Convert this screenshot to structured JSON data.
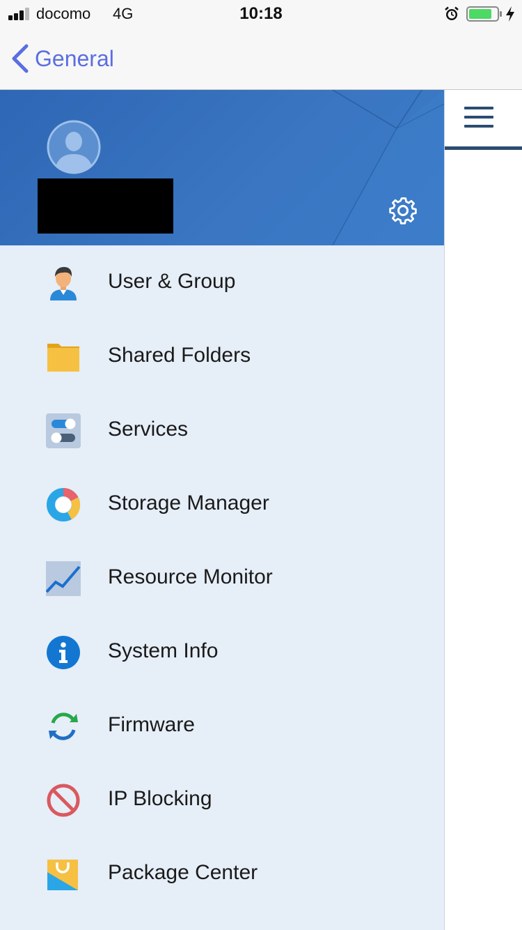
{
  "status_bar": {
    "carrier": "docomo",
    "network": "4G",
    "time": "10:18",
    "battery_color": "#4cd964"
  },
  "nav": {
    "back_label": "General",
    "accent_color": "#5b6ee1"
  },
  "drawer": {
    "header_color": "#3371bd",
    "menu_items": [
      {
        "label": "User & Group",
        "icon": "user-icon"
      },
      {
        "label": "Shared Folders",
        "icon": "folder-icon"
      },
      {
        "label": "Services",
        "icon": "toggles-icon"
      },
      {
        "label": "Storage Manager",
        "icon": "donut-chart-icon"
      },
      {
        "label": "Resource Monitor",
        "icon": "line-chart-icon"
      },
      {
        "label": "System Info",
        "icon": "info-icon"
      },
      {
        "label": "Firmware",
        "icon": "refresh-icon"
      },
      {
        "label": "IP Blocking",
        "icon": "block-icon"
      },
      {
        "label": "Package Center",
        "icon": "shopping-bag-icon"
      }
    ]
  }
}
